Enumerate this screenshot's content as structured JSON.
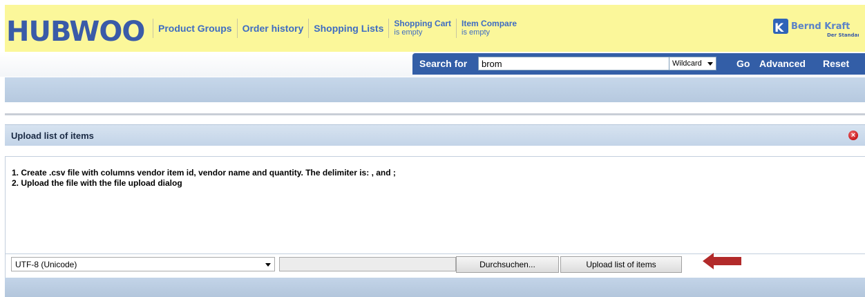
{
  "header": {
    "logo_text": "HUBWOO",
    "nav": [
      {
        "label": "Product Groups"
      },
      {
        "label": "Order history"
      },
      {
        "label": "Shopping Lists"
      }
    ],
    "cart": {
      "title": "Shopping Cart",
      "status": "is empty"
    },
    "compare": {
      "title": "Item Compare",
      "status": "is empty"
    },
    "brand": {
      "name": "Bernd Kraft",
      "tagline": "Der Standard"
    }
  },
  "search": {
    "label": "Search for",
    "value": "brom",
    "mode": "Wildcard",
    "go": "Go",
    "advanced": "Advanced",
    "reset": "Reset"
  },
  "panel": {
    "title": "Upload list of items",
    "instructions": [
      "1. Create .csv file with columns vendor item id, vendor name and quantity. The delimiter is: , and ;",
      "2. Upload the file with the file upload dialog"
    ],
    "encoding": "UTF-8 (Unicode)",
    "browse_label": "Durchsuchen...",
    "upload_label": "Upload list of items"
  },
  "colors": {
    "header_bg": "#fbf79a",
    "nav_link": "#3e6cc2",
    "search_bar": "#335ea7",
    "arrow": "#b22a2a",
    "close": "#c8161a"
  }
}
